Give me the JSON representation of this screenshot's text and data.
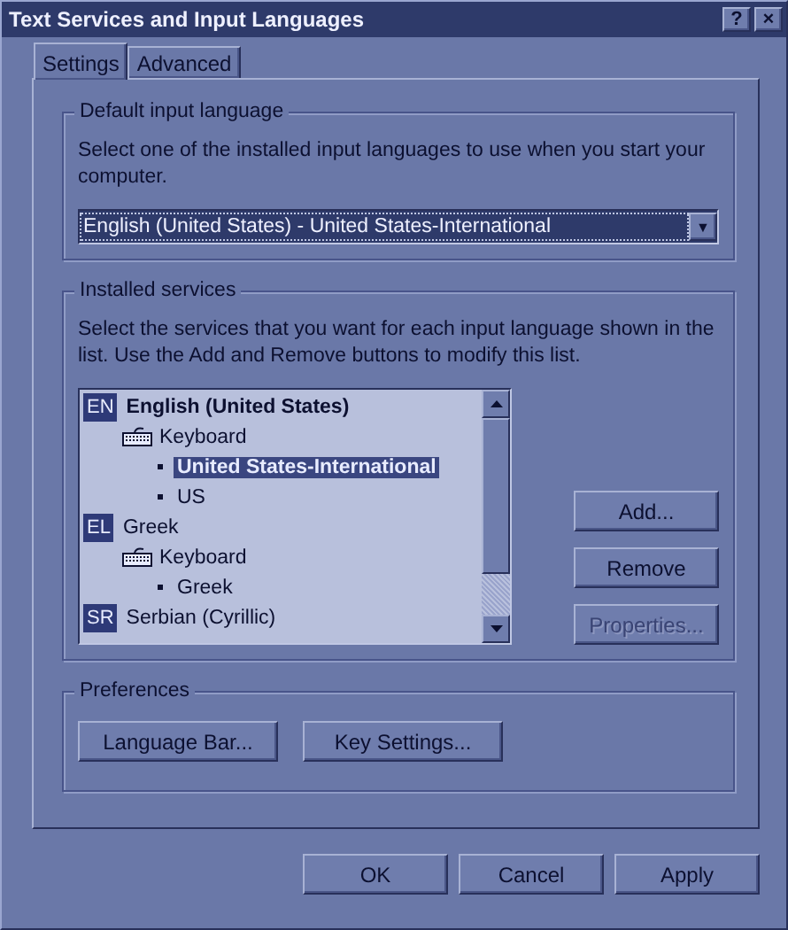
{
  "window": {
    "title": "Text Services and Input Languages",
    "title_buttons": [
      "?",
      "×"
    ]
  },
  "tabs": [
    {
      "label": "Settings",
      "selected": true
    },
    {
      "label": "Advanced",
      "selected": false
    }
  ],
  "default_input_language": {
    "legend": "Default input language",
    "description": "Select one of the installed input languages to use when you start your computer.",
    "dropdown": {
      "value": "English (United States) - United States-International",
      "arrow": "▼"
    }
  },
  "installed_services": {
    "legend": "Installed services",
    "description": "Select the services that you want for each input language shown in the list. Use the Add and Remove buttons to modify this list.",
    "languages": [
      {
        "badge": "EN",
        "name": "English (United States)",
        "default": true,
        "children": [
          {
            "label": "Keyboard",
            "children": [
              {
                "label": "United States-International",
                "selected": true
              },
              {
                "label": "US",
                "selected": false
              }
            ]
          }
        ]
      },
      {
        "badge": "EL",
        "name": "Greek",
        "default": false,
        "children": [
          {
            "label": "Keyboard",
            "children": [
              {
                "label": "Greek",
                "selected": false
              }
            ]
          }
        ]
      },
      {
        "badge": "SR",
        "name": "Serbian (Cyrillic)",
        "default": false
      }
    ],
    "buttons": [
      {
        "label": "Add...",
        "disabled": false
      },
      {
        "label": "Remove",
        "disabled": false
      },
      {
        "label": "Properties...",
        "disabled": true
      }
    ]
  },
  "preferences": {
    "legend": "Preferences",
    "buttons": [
      {
        "label": "Language Bar..."
      },
      {
        "label": "Key Settings..."
      }
    ]
  },
  "buttons": [
    {
      "label": "OK"
    },
    {
      "label": "Cancel"
    },
    {
      "label": "Apply"
    }
  ]
}
